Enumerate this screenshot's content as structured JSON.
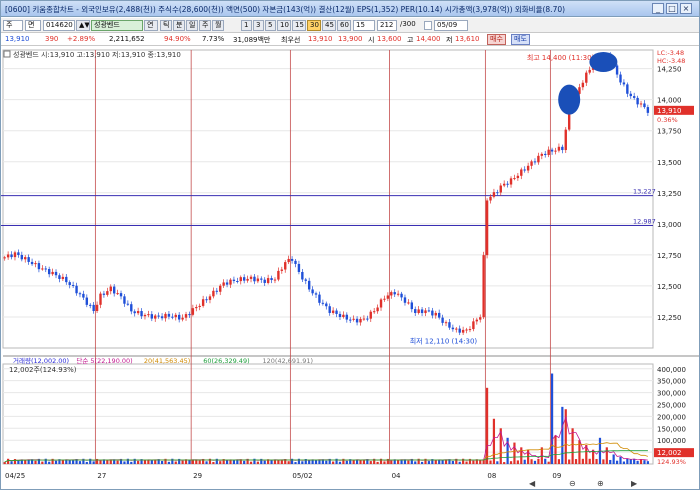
{
  "window": {
    "title": "[0600] 키움종합차트 - 외국인보유(2,488(천)) 주식수(28,600(천)) 액면(500) 자본금(143(억)) 결산(12월) EPS(1,352) PER(10.14) 시가총액(3,978(억)) 외화비율(8.70)",
    "buttons": [
      "_",
      "□",
      "×"
    ]
  },
  "toolbar": {
    "combo1": "주",
    "combo2": "면",
    "code": "014620",
    "spinner": "▲▼",
    "stock_name": "성광벤드",
    "hold_label": "연",
    "periods": [
      "틱",
      "분",
      "일",
      "주",
      "월",
      "1",
      "3",
      "5",
      "10",
      "15",
      "30",
      "45",
      "60",
      "15"
    ],
    "active_period": "30",
    "count": "212",
    "count_suffix": "/300",
    "date": "05/09"
  },
  "quote": {
    "price": "13,910",
    "change": "390",
    "change_pct": "+2.89%",
    "volume": "2,211,652",
    "vol_ratio": "94.90%",
    "turnover": "7.73%",
    "amount": "31,089백만",
    "ma_label": "최우선",
    "bid": "13,910",
    "ask": "13,900",
    "open_label": "시",
    "open": "13,600",
    "high_label": "고",
    "high": "14,400",
    "low_label": "저",
    "low": "13,610",
    "buy_btn": "매수",
    "sell_btn": "매도"
  },
  "price_panel": {
    "legend": "성광벤드 시:13,910 고:13,910 저:13,910 종:13,910",
    "high_annotation": "최고 14,400 (11:30)",
    "low_annotation": "최저 12,110 (14:30)",
    "price_axis": [
      "14,250",
      "14,000",
      "13,750",
      "13,500",
      "13,250",
      "13,000",
      "12,750",
      "12,500",
      "12,250"
    ],
    "current_tag": "13,910",
    "current_pct": "0.36%",
    "corner_info_1": "LC:-3.48",
    "corner_info_2": "HC:-3.48",
    "hline_1": "13,227",
    "hline_2": "12,987"
  },
  "volume_panel": {
    "legend_items": [
      {
        "text": "거래량(12,002.00)",
        "color": "#2b2bd8"
      },
      {
        "text": "단순 5(22,190.00)",
        "color": "#c2188f"
      },
      {
        "text": "20(41,563.45)",
        "color": "#d08a00"
      },
      {
        "text": "60(26,329.49)",
        "color": "#1c9e3a"
      },
      {
        "text": "120(42,691.91)",
        "color": "#7b7b7b"
      }
    ],
    "legend_2": "12,002주(124.93%)",
    "volume_axis": [
      "400,000",
      "350,000",
      "300,000",
      "250,000",
      "200,000",
      "150,000",
      "100,000",
      "50,000"
    ],
    "current_tag": "12,002",
    "current_pct": "124.93%"
  },
  "time_axis": [
    "04/25",
    "27",
    "29",
    "05/02",
    "04",
    "08",
    "09"
  ],
  "chart_data": {
    "type": "candlestick",
    "title": "",
    "price_ylim": [
      12000,
      14400
    ],
    "volume_ylim": [
      0,
      420000
    ],
    "day_labels": [
      "04/25",
      "27",
      "29",
      "05/02",
      "04",
      "08",
      "09"
    ],
    "current_price": 13910,
    "high": {
      "value": 14400,
      "label": "최고 14,400 (11:30)"
    },
    "low": {
      "value": 12110,
      "label": "최저 12,110 (14:30)"
    },
    "hlines": [
      13227,
      12987
    ],
    "price_path": [
      [
        0,
        12730
      ],
      [
        3,
        12760
      ],
      [
        7,
        12700
      ],
      [
        10,
        12650
      ],
      [
        14,
        12600
      ],
      [
        18,
        12540
      ],
      [
        22,
        12430
      ],
      [
        26,
        12300
      ],
      [
        28,
        12420
      ],
      [
        31,
        12480
      ],
      [
        34,
        12410
      ],
      [
        37,
        12300
      ],
      [
        40,
        12270
      ],
      [
        44,
        12250
      ],
      [
        48,
        12260
      ],
      [
        52,
        12240
      ],
      [
        56,
        12330
      ],
      [
        60,
        12420
      ],
      [
        64,
        12520
      ],
      [
        68,
        12550
      ],
      [
        72,
        12560
      ],
      [
        76,
        12540
      ],
      [
        79,
        12560
      ],
      [
        82,
        12690
      ],
      [
        84,
        12720
      ],
      [
        86,
        12610
      ],
      [
        89,
        12480
      ],
      [
        92,
        12380
      ],
      [
        95,
        12300
      ],
      [
        99,
        12250
      ],
      [
        102,
        12220
      ],
      [
        105,
        12230
      ],
      [
        108,
        12300
      ],
      [
        111,
        12410
      ],
      [
        114,
        12450
      ],
      [
        117,
        12380
      ],
      [
        120,
        12290
      ],
      [
        123,
        12300
      ],
      [
        126,
        12270
      ],
      [
        129,
        12190
      ],
      [
        132,
        12140
      ],
      [
        135,
        12140
      ],
      [
        137,
        12200
      ],
      [
        139,
        12260
      ],
      [
        141,
        13200
      ],
      [
        143,
        13240
      ],
      [
        145,
        13300
      ],
      [
        148,
        13350
      ],
      [
        151,
        13420
      ],
      [
        154,
        13490
      ],
      [
        157,
        13560
      ],
      [
        160,
        13590
      ],
      [
        163,
        13610
      ],
      [
        165,
        13900
      ],
      [
        168,
        14100
      ],
      [
        171,
        14250
      ],
      [
        174,
        14330
      ],
      [
        176,
        14350
      ],
      [
        178,
        14260
      ],
      [
        180,
        14150
      ],
      [
        182,
        14060
      ],
      [
        184,
        14000
      ],
      [
        186,
        13960
      ],
      [
        188,
        13910
      ]
    ],
    "volume_spikes": [
      [
        141,
        320000
      ],
      [
        143,
        190000
      ],
      [
        145,
        150000
      ],
      [
        147,
        110000
      ],
      [
        149,
        90000
      ],
      [
        151,
        70000
      ],
      [
        153,
        60000
      ],
      [
        157,
        70000
      ],
      [
        160,
        380000
      ],
      [
        161,
        120000
      ],
      [
        163,
        240000
      ],
      [
        164,
        230000
      ],
      [
        166,
        150000
      ],
      [
        168,
        100000
      ],
      [
        170,
        80000
      ],
      [
        172,
        60000
      ],
      [
        174,
        110000
      ],
      [
        176,
        70000
      ],
      [
        178,
        40000
      ],
      [
        180,
        30000
      ],
      [
        183,
        20000
      ],
      [
        188,
        12002
      ]
    ],
    "ma_series": [
      {
        "name": "단순 5",
        "color": "#c2188f"
      },
      {
        "name": "20",
        "color": "#d08a00"
      },
      {
        "name": "60",
        "color": "#1c9e3a"
      },
      {
        "name": "120",
        "color": "#7b7b7b"
      }
    ]
  },
  "colors": {
    "up": "#e0302a",
    "down": "#1f4fd8",
    "divider": "#c44d4d",
    "hline": "#3a2fb3",
    "grid": "#e7e7e7"
  },
  "icons": {
    "bottom_bar": [
      "left-arrow-icon",
      "zoom-out-icon",
      "zoom-in-icon",
      "right-arrow-icon"
    ]
  }
}
